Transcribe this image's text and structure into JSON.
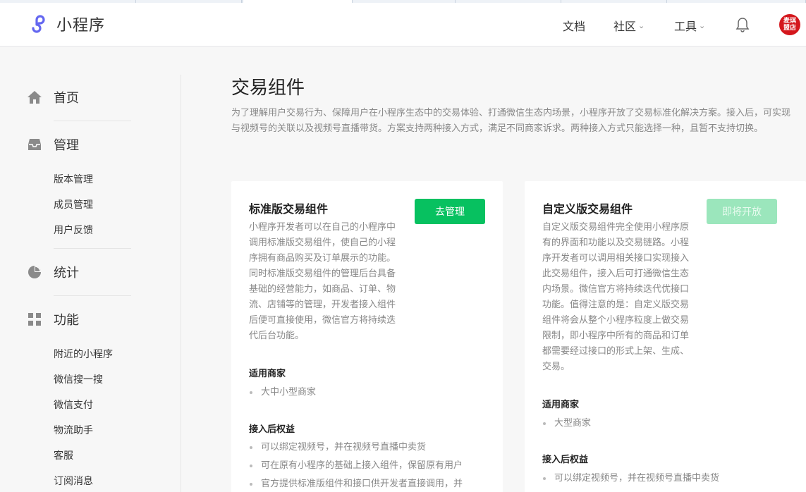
{
  "app": {
    "logo_text": "小程序",
    "brand_color": "#6467f0"
  },
  "topnav": {
    "docs": "文档",
    "community": "社区",
    "tools": "工具",
    "avatar_text": "麦琪 盟店"
  },
  "sidebar": {
    "home": "首页",
    "manage": "管理",
    "manage_items": [
      "版本管理",
      "成员管理",
      "用户反馈"
    ],
    "stats": "统计",
    "functions": "功能",
    "function_items": [
      "附近的小程序",
      "微信搜一搜",
      "微信支付",
      "物流助手",
      "客服",
      "订阅消息"
    ]
  },
  "page": {
    "title": "交易组件",
    "description": "为了理解用户交易行为、保障用户在小程序生态中的交易体验、打通微信生态内场景，小程序开放了交易标准化解决方案。接入后，可实现与视频号的关联以及视频号直播带货。方案支持两种接入方式，满足不同商家诉求。两种接入方式只能选择一种，且暂不支持切换。"
  },
  "cards": [
    {
      "title": "标准版交易组件",
      "button": "去管理",
      "description": "小程序开发者可以在自己的小程序中调用标准版交易组件，使自己的小程序拥有商品购买及订单展示的功能。同时标准版交易组件的管理后台具备基础的经营能力，如商品、订单、物流、店铺等的管理，开发者接入组件后便可直接使用，微信官方将持续迭代后台功能。",
      "merchants_heading": "适用商家",
      "merchants": [
        "大中小型商家"
      ],
      "benefits_heading": "接入后权益",
      "benefits": [
        "可以绑定视频号，并在视频号直播中卖货",
        "可在原有小程序的基础上接入组件，保留原有用户",
        "官方提供标准版组件和接口供开发者直接调用，并"
      ]
    },
    {
      "title": "自定义版交易组件",
      "button": "即将开放",
      "description": "自定义版交易组件完全使用小程序原有的界面和功能以及交易链路。小程序开发者可以调用相关接口实现接入此交易组件，接入后可打通微信生态内场景。微信官方将持续迭代优接口功能。值得注意的是：自定义版交易组件将会从整个小程序粒度上做交易限制，即小程序中所有的商品和订单都需要经过接口的形式上架、生成、交易。",
      "merchants_heading": "适用商家",
      "merchants": [
        "大型商家"
      ],
      "benefits_heading": "接入后权益",
      "benefits": [
        "可以绑定视频号，并在视频号直播中卖货"
      ]
    }
  ]
}
